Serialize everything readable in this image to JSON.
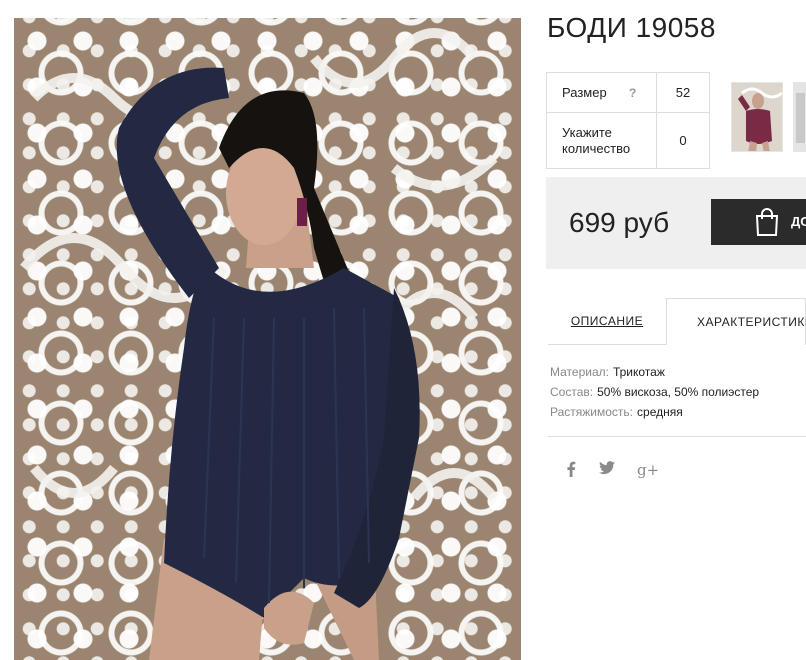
{
  "product": {
    "title": "БОДИ 19058",
    "image_alt": "Модель в тёмно-синем боди на фоне резного узора"
  },
  "options": {
    "size_label": "Размер",
    "size_help": "?",
    "size_value": "52",
    "qty_label": "Укажите количество",
    "qty_value": "0"
  },
  "thumbnails": [
    {
      "name": "thumb-burgundy",
      "color": "#7a2a45"
    },
    {
      "name": "thumb-second",
      "color": "#cfcfcf"
    }
  ],
  "price": {
    "value": "699 руб",
    "cart_label": "ДО"
  },
  "tabs": {
    "description": "ОПИСАНИЕ",
    "characteristics": "ХАРАКТЕРИСТИКИ"
  },
  "specs": [
    {
      "key": "Материал:",
      "value": "Трикотаж"
    },
    {
      "key": "Состав:",
      "value": "50% вискоза, 50% полиэстер"
    },
    {
      "key": "Растяжимость:",
      "value": "средняя"
    }
  ],
  "social": {
    "facebook": "f",
    "twitter": "🐦",
    "googleplus": "g+"
  },
  "colors": {
    "garment": "#232943",
    "price_bg": "#efefef",
    "button_bg": "#2b2b2b"
  }
}
